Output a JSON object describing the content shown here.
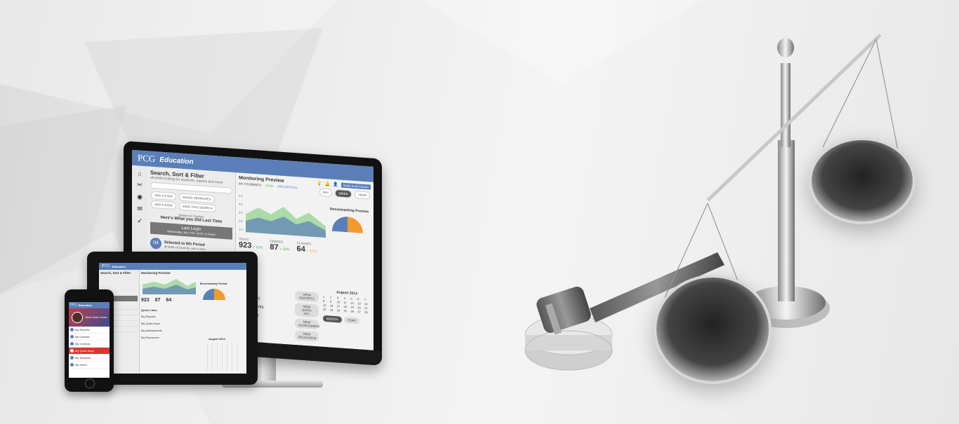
{
  "colors": {
    "brand_blue": "#5a7fb8",
    "accent_orange": "#f29a2e",
    "active_red": "#d33c3c",
    "chart_green": "#8fd18a"
  },
  "monitor": {
    "logo": "PCG",
    "app_name": "Education",
    "left_panel": {
      "title": "Search, Sort & Filter",
      "subtitle": "all while looking for students, reports and more",
      "pills": [
        "ADD FILTER",
        "SAVED SEARCHES",
        "ADD FILTER",
        "SAVE THIS SEARCH"
      ],
      "prompt_small": "Based on Tracker",
      "prompt": "Here's What you Did Last Time",
      "last_login_label": "Last Login",
      "last_login_value": "Wednesday, July 17th, 2013 | 11:01am",
      "badge": "04",
      "assigned_title": "Selected to 8th Period",
      "assigned_sub": "all ability of students, with a mind"
    },
    "main": {
      "title": "Monitoring Preview",
      "legend_label": "MY STUDENTS",
      "legend": [
        "HIGH",
        "INFLUENTIAL"
      ],
      "range_tabs": [
        "DAY",
        "WEEK",
        "YEAR"
      ],
      "y_ticks": [
        "5.0",
        "4.0",
        "3.0",
        "2.0",
        "1.0"
      ],
      "x_ticks": [
        "JAN",
        "FEB",
        "MAR",
        "APR",
        "MAY",
        "JUN",
        "JUL"
      ],
      "stats": [
        {
          "label": "TESTS",
          "value": "923",
          "delta": "+ 15%"
        },
        {
          "label": "GRADES",
          "value": "87",
          "delta": "+ 33%"
        },
        {
          "label": "CLASSES",
          "value": "64",
          "delta": "+ 17%"
        }
      ],
      "bench_title": "Benchmarking Preview",
      "quick_links": [
        "Reports",
        "Quick Keys",
        "Assessments",
        "Resources"
      ],
      "right_buttons": [
        "VIEW REPORTS",
        "NEW QUICK KEY",
        "NEW ASSESSMENT",
        "NEW RESOURCE"
      ],
      "calendar_title": "August 2013",
      "calendar_buttons": [
        "MONTH",
        "YEAR"
      ]
    },
    "top_right": {
      "user": "Sarah Smith-Houser"
    }
  },
  "tablet": {
    "logo": "PCG",
    "app_name": "Education",
    "title": "Search, Sort & Filter",
    "main_title": "Monitoring Preview",
    "bench_title": "Benchmarking Preview",
    "stats": [
      "923",
      "87",
      "64"
    ],
    "quick_links_title": "Quick Links",
    "quick_links": [
      "My Reports",
      "My Quick Keys",
      "My Assessments",
      "My Resources"
    ],
    "calendar_title": "August 2013"
  },
  "phone": {
    "logo": "PCG",
    "app_name": "Education",
    "user": "Sarah Smith-Houser",
    "menu": [
      {
        "label": "My Reports",
        "active": false
      },
      {
        "label": "My Classes",
        "active": false
      },
      {
        "label": "My Controls",
        "active": false
      },
      {
        "label": "My Quick Keys",
        "active": true
      },
      {
        "label": "My Students",
        "active": false
      },
      {
        "label": "My Peers",
        "active": false
      }
    ]
  },
  "icons": [
    "home-icon",
    "tools-icon",
    "eye-icon",
    "mail-icon",
    "rocket-icon",
    "lightbulb-icon",
    "bell-icon",
    "user-icon",
    "gavel-icon",
    "scales-icon"
  ]
}
